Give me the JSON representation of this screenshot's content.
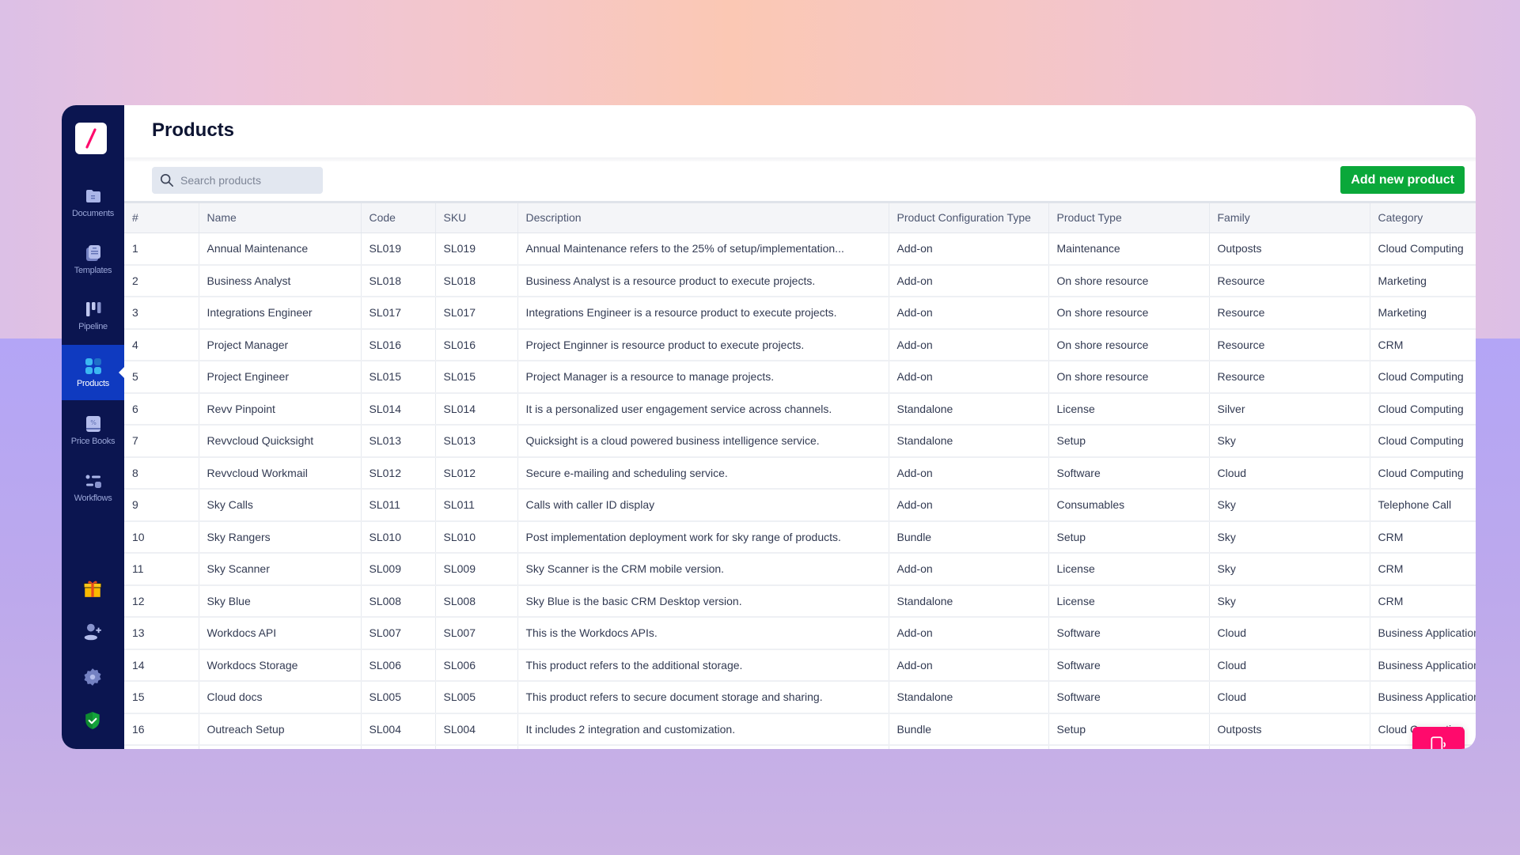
{
  "sidebar": {
    "logo": "slash-logo",
    "nav": [
      {
        "label": "Documents",
        "icon": "folder-icon",
        "active": false
      },
      {
        "label": "Templates",
        "icon": "template-icon",
        "active": false
      },
      {
        "label": "Pipeline",
        "icon": "pipeline-icon",
        "active": false
      },
      {
        "label": "Products",
        "icon": "grid-icon",
        "active": true
      },
      {
        "label": "Price Books",
        "icon": "price-book-icon",
        "active": false
      },
      {
        "label": "Workflows",
        "icon": "workflow-icon",
        "active": false
      }
    ],
    "bottom_icons": [
      "gift-icon",
      "add-user-icon",
      "gear-icon",
      "shield-check-icon"
    ]
  },
  "header": {
    "title": "Products"
  },
  "toolbar": {
    "search_placeholder": "Search products",
    "search_value": "",
    "add_button": "Add new product"
  },
  "colors": {
    "sidebar_bg": "#0b1550",
    "active_nav": "#0f3ac0",
    "primary_button": "#0aa83a",
    "fab": "#ff0a6c",
    "logo_slash": "#ff0a6c"
  },
  "table": {
    "columns": [
      "#",
      "Name",
      "Code",
      "SKU",
      "Description",
      "Product Configuration Type",
      "Product Type",
      "Family",
      "Category"
    ],
    "rows": [
      [
        "1",
        "Annual Maintenance",
        "SL019",
        "SL019",
        "Annual Maintenance refers to the 25% of setup/implementation...",
        "Add-on",
        "Maintenance",
        "Outposts",
        "Cloud Computing"
      ],
      [
        "2",
        "Business Analyst",
        "SL018",
        "SL018",
        "Business Analyst is a resource product to execute projects.",
        "Add-on",
        "On shore resource",
        "Resource",
        "Marketing"
      ],
      [
        "3",
        "Integrations Engineer",
        "SL017",
        "SL017",
        "Integrations Engineer is a resource product to execute projects.",
        "Add-on",
        "On shore resource",
        "Resource",
        "Marketing"
      ],
      [
        "4",
        "Project Manager",
        "SL016",
        "SL016",
        "Project Enginner is resource product to execute projects.",
        "Add-on",
        "On shore resource",
        "Resource",
        "CRM"
      ],
      [
        "5",
        "Project Engineer",
        "SL015",
        "SL015",
        "Project Manager is a resource to manage projects.",
        "Add-on",
        "On shore resource",
        "Resource",
        "Cloud Computing"
      ],
      [
        "6",
        "Revv Pinpoint",
        "SL014",
        "SL014",
        "It is a personalized user engagement service across channels.",
        "Standalone",
        "License",
        "Silver",
        "Cloud Computing"
      ],
      [
        "7",
        "Revvcloud Quicksight",
        "SL013",
        "SL013",
        "Quicksight is a cloud powered business intelligence service.",
        "Standalone",
        "Setup",
        "Sky",
        "Cloud Computing"
      ],
      [
        "8",
        "Revvcloud Workmail",
        "SL012",
        "SL012",
        "Secure e-mailing and scheduling service.",
        "Add-on",
        "Software",
        "Cloud",
        "Cloud Computing"
      ],
      [
        "9",
        "Sky Calls",
        "SL011",
        "SL011",
        "Calls with caller ID display",
        "Add-on",
        "Consumables",
        "Sky",
        "Telephone Call"
      ],
      [
        "10",
        "Sky Rangers",
        "SL010",
        "SL010",
        "Post implementation deployment work for sky range of products.",
        "Bundle",
        "Setup",
        "Sky",
        "CRM"
      ],
      [
        "11",
        "Sky Scanner",
        "SL009",
        "SL009",
        "Sky Scanner is the CRM mobile version.",
        "Add-on",
        "License",
        "Sky",
        "CRM"
      ],
      [
        "12",
        "Sky Blue",
        "SL008",
        "SL008",
        "Sky Blue is the basic CRM Desktop version.",
        "Standalone",
        "License",
        "Sky",
        "CRM"
      ],
      [
        "13",
        "Workdocs API",
        "SL007",
        "SL007",
        "This is the Workdocs APIs.",
        "Add-on",
        "Software",
        "Cloud",
        "Business Applications"
      ],
      [
        "14",
        "Workdocs Storage",
        "SL006",
        "SL006",
        "This product refers to the additional storage.",
        "Add-on",
        "Software",
        "Cloud",
        "Business Applications"
      ],
      [
        "15",
        "Cloud docs",
        "SL005",
        "SL005",
        "This product refers to secure document storage and sharing.",
        "Standalone",
        "Software",
        "Cloud",
        "Business Applications"
      ],
      [
        "16",
        "Outreach Setup",
        "SL004",
        "SL004",
        "It includes 2 integration and customization.",
        "Bundle",
        "Setup",
        "Outposts",
        "Cloud Computing"
      ],
      [
        "",
        "",
        "",
        "",
        "",
        "",
        "",
        "",
        ""
      ]
    ]
  },
  "fab": {
    "icon": "chat-device-icon"
  }
}
